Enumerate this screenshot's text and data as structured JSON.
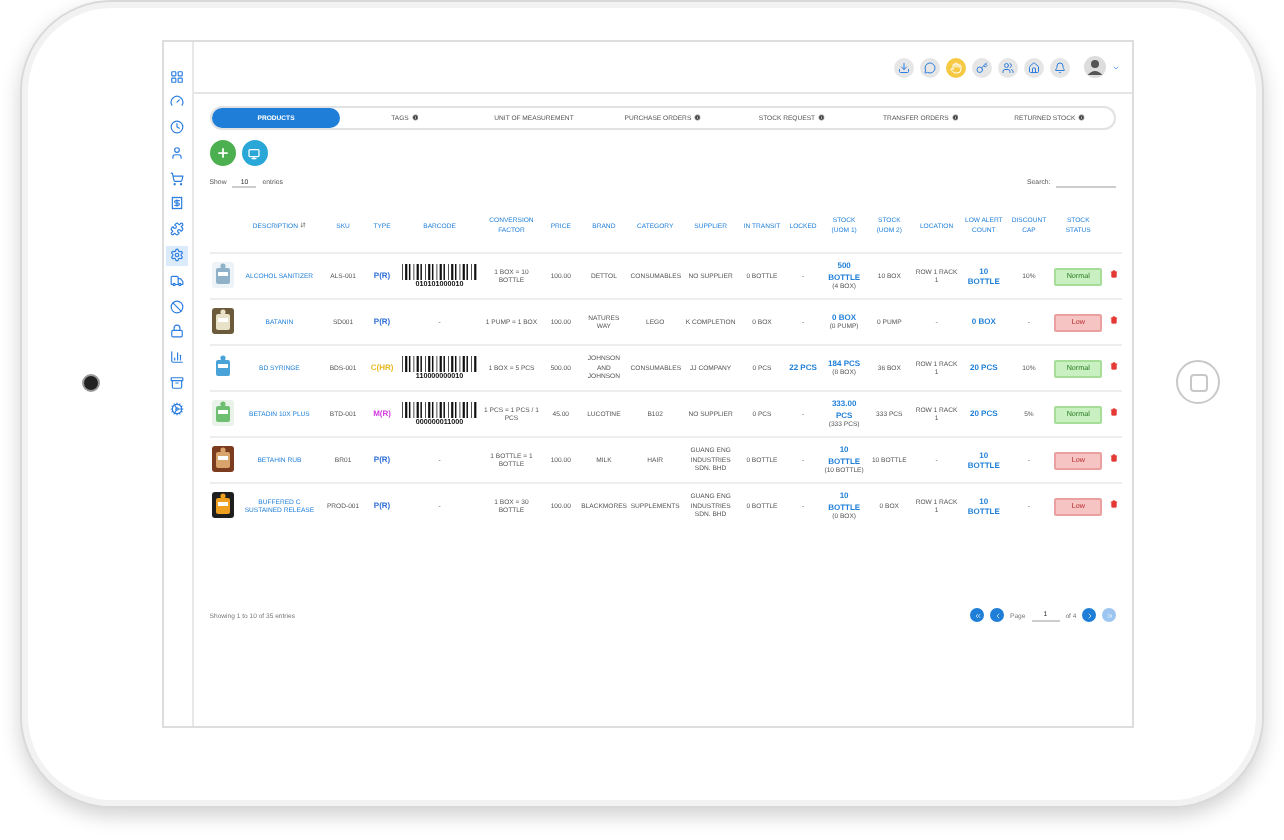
{
  "sidebar": [
    {
      "selected": false
    },
    {
      "selected": false
    },
    {
      "selected": false
    },
    {
      "selected": false
    },
    {
      "selected": false
    },
    {
      "selected": false
    },
    {
      "selected": false
    },
    {
      "selected": true
    },
    {
      "selected": false
    },
    {
      "selected": false
    },
    {
      "selected": false
    },
    {
      "selected": false
    },
    {
      "selected": false
    },
    {
      "selected": false
    }
  ],
  "toolbar": [
    {
      "selected": false
    },
    {
      "selected": false
    },
    {
      "selected": true
    },
    {
      "selected": false
    },
    {
      "selected": false
    },
    {
      "selected": false
    },
    {
      "selected": false
    }
  ],
  "tabs": [
    {
      "label": "PRODUCTS",
      "selected": true,
      "info": false
    },
    {
      "label": "TAGS",
      "selected": false,
      "info": true
    },
    {
      "label": "UNIT OF MEASUREMENT",
      "selected": false,
      "info": false
    },
    {
      "label": "PURCHASE ORDERS",
      "selected": false,
      "info": true
    },
    {
      "label": "STOCK REQUEST",
      "selected": false,
      "info": true
    },
    {
      "label": "TRANSFER ORDERS",
      "selected": false,
      "info": true
    },
    {
      "label": "RETURNED STOCK",
      "selected": false,
      "info": true
    }
  ],
  "length": {
    "before": "Show",
    "value": "10",
    "after": "entries"
  },
  "search": {
    "label": "Search:"
  },
  "columns": [
    "DESCRIPTION",
    "SKU",
    "TYPE",
    "BARCODE",
    "CONVERSION FACTOR",
    "PRICE",
    "BRAND",
    "CATEGORY",
    "SUPPLIER",
    "IN TRANSIT",
    "LOCKED",
    "STOCK (UOM 1)",
    "STOCK (UOM 2)",
    "LOCATION",
    "LOW ALERT COUNT",
    "DISCOUNT CAP",
    "STOCK STATUS"
  ],
  "rows": [
    {
      "description": "ALCOHOL SANITIZER",
      "sku": "ALS-001",
      "type": {
        "label": "P(R)",
        "color": "#2f6fd6"
      },
      "barcode": "010101000010",
      "conversion": "1 BOX = 10 BOTTLE",
      "price": "100.00",
      "brand": "DETTOL",
      "category": "CONSUMABLES",
      "supplier": "NO SUPPLIER",
      "in_transit": "0 BOTTLE",
      "locked": "-",
      "stock_uom1": {
        "value": "500 BOTTLE",
        "note": "(4 BOX)"
      },
      "stock_uom2": "10 BOX",
      "location": "ROW 1 RACK 1",
      "low_alert": "10 BOTTLE",
      "discount": "10%",
      "status": {
        "label": "Normal",
        "kind": "normal"
      }
    },
    {
      "description": "BATANIN",
      "sku": "SD001",
      "type": {
        "label": "P(R)",
        "color": "#2f6fd6"
      },
      "barcode": "-",
      "conversion": "1 PUMP = 1 BOX",
      "price": "100.00",
      "brand": "NATURES WAY",
      "category": "LEGO",
      "supplier": "K COMPLETION",
      "in_transit": "0 BOX",
      "locked": "-",
      "stock_uom1": {
        "value": "0 BOX",
        "note": "(0 PUMP)"
      },
      "stock_uom2": "0 PUMP",
      "location": "-",
      "low_alert": "0 BOX",
      "discount": "-",
      "status": {
        "label": "Low",
        "kind": "low"
      }
    },
    {
      "description": "BD SYRINGE",
      "sku": "BDS-001",
      "type": {
        "label": "C(HR)",
        "color": "#e8b820"
      },
      "barcode": "110000000010",
      "conversion": "1 BOX = 5 PCS",
      "price": "500.00",
      "brand": "JOHNSON AND JOHNSON",
      "category": "CONSUMABLES",
      "supplier": "JJ COMPANY",
      "in_transit": "0 PCS",
      "locked": "22 PCS",
      "stock_uom1": {
        "value": "184 PCS",
        "note": "(8 BOX)"
      },
      "stock_uom2": "36 BOX",
      "location": "ROW 1 RACK 1",
      "low_alert": "20 PCS",
      "discount": "10%",
      "status": {
        "label": "Normal",
        "kind": "normal"
      }
    },
    {
      "description": "BETADIN 10X PLUS",
      "sku": "BTD-001",
      "type": {
        "label": "M(R)",
        "color": "#d23be0"
      },
      "barcode": "000000011000",
      "conversion": "1 PCS = 1 PCS / 1 PCS",
      "price": "45.00",
      "brand": "LUCOTINE",
      "category": "B102",
      "supplier": "NO SUPPLIER",
      "in_transit": "0 PCS",
      "locked": "-",
      "stock_uom1": {
        "value": "333.00 PCS",
        "note": "(333 PCS)"
      },
      "stock_uom2": "333 PCS",
      "location": "ROW 1 RACK 1",
      "low_alert": "20 PCS",
      "discount": "5%",
      "status": {
        "label": "Normal",
        "kind": "normal"
      }
    },
    {
      "description": "BETAHIN RUB",
      "sku": "BR01",
      "type": {
        "label": "P(R)",
        "color": "#2f6fd6"
      },
      "barcode": "-",
      "conversion": "1 BOTTLE = 1 BOTTLE",
      "price": "100.00",
      "brand": "MILK",
      "category": "HAIR",
      "supplier": "GUANG ENG INDUSTRIES SDN. BHD",
      "in_transit": "0 BOTTLE",
      "locked": "-",
      "stock_uom1": {
        "value": "10 BOTTLE",
        "note": "(10 BOTTLE)"
      },
      "stock_uom2": "10 BOTTLE",
      "location": "-",
      "low_alert": "10 BOTTLE",
      "discount": "-",
      "status": {
        "label": "Low",
        "kind": "low"
      }
    },
    {
      "description": "BUFFERED C SUSTAINED RELEASE",
      "sku": "PROD-001",
      "type": {
        "label": "P(R)",
        "color": "#2f6fd6"
      },
      "barcode": "-",
      "conversion": "1 BOX = 30 BOTTLE",
      "price": "100.00",
      "brand": "BLACKMORES",
      "category": "SUPPLEMENTS",
      "supplier": "GUANG ENG INDUSTRIES SDN. BHD",
      "in_transit": "0 BOTTLE",
      "locked": "-",
      "stock_uom1": {
        "value": "10 BOTTLE",
        "note": "(0 BOX)"
      },
      "stock_uom2": "0 BOX",
      "location": "ROW 1 RACK 1",
      "low_alert": "10 BOTTLE",
      "discount": "-",
      "status": {
        "label": "Low",
        "kind": "low"
      }
    }
  ],
  "footer": {
    "info": "Showing 1 to 10 of 35 entries",
    "page_label": "Page",
    "page": "1",
    "page_total": "of 4"
  }
}
